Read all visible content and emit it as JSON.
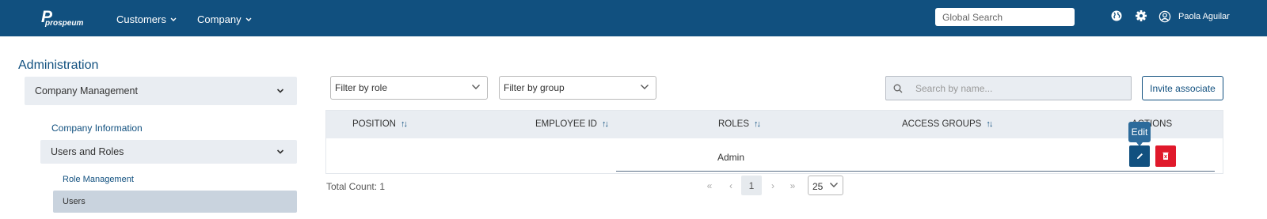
{
  "header": {
    "logo_mark": "P",
    "logo_text": "prospeum",
    "nav": [
      {
        "label": "Customers"
      },
      {
        "label": "Company"
      }
    ],
    "search_placeholder": "Global Search",
    "icons": [
      "globe-icon",
      "gear-icon",
      "user-circle-icon"
    ],
    "user_name": "Paola Aguilar"
  },
  "sidebar": {
    "title": "Administration",
    "company_management": "Company Management",
    "company_information": "Company Information",
    "users_and_roles": "Users and Roles",
    "role_management": "Role Management",
    "users": "Users"
  },
  "filters": {
    "role": "Filter by role",
    "group": "Filter by group",
    "search_placeholder": "Search by name...",
    "invite": "Invite associate"
  },
  "table": {
    "columns": [
      "POSITION",
      "EMPLOYEE ID",
      "ROLES",
      "ACCESS GROUPS",
      "ACTIONS"
    ],
    "rows": [
      {
        "position": "",
        "employee_id": "",
        "roles": "Admin",
        "access_groups": ""
      }
    ],
    "edit_tooltip": "Edit"
  },
  "footer": {
    "total_count": "Total Count: 1",
    "current_page": "1",
    "page_size": "25"
  },
  "colors": {
    "brand": "#11507f",
    "danger": "#e0192b",
    "panel": "#e9edf2",
    "active": "#c9d3de"
  }
}
